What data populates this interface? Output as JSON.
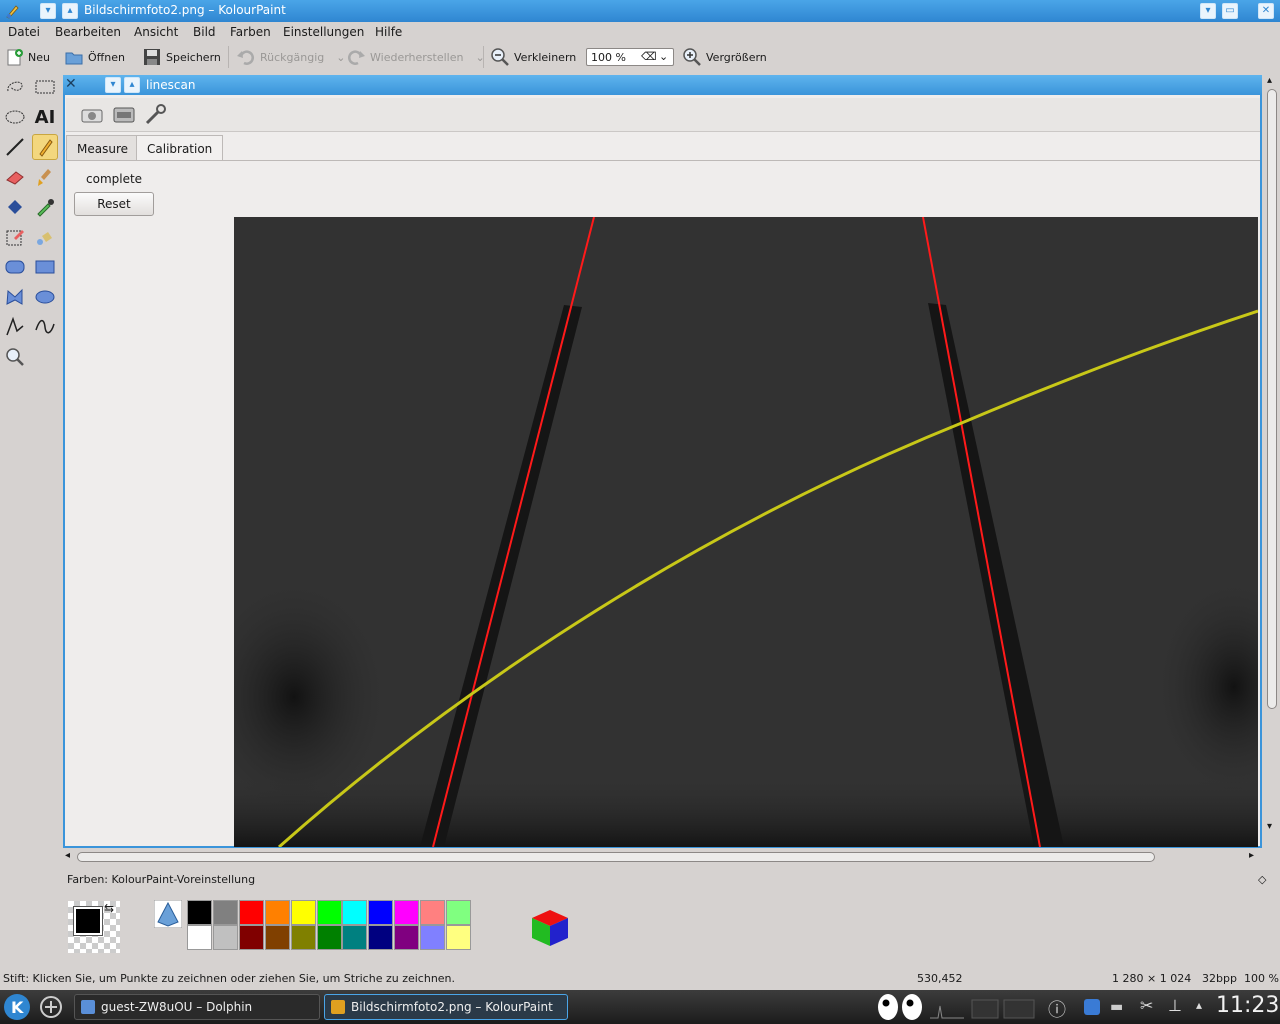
{
  "window": {
    "title": "Bildschirmfoto2.png – KolourPaint"
  },
  "menu": [
    "Datei",
    "Bearbeiten",
    "Ansicht",
    "Bild",
    "Farben",
    "Einstellungen",
    "Hilfe"
  ],
  "toolbar": {
    "new": "Neu",
    "open": "Öffnen",
    "save": "Speichern",
    "undo": "Rückgängig",
    "redo": "Wiederherstellen",
    "zoom_out": "Verkleinern",
    "zoom_value": "100 %",
    "zoom_in": "Vergrößern"
  },
  "plugin": {
    "title": "linescan",
    "tabs": [
      "Measure",
      "Calibration"
    ],
    "active_tab": "Calibration",
    "status": "complete",
    "reset_label": "Reset"
  },
  "colors": {
    "label": "Farben: KolourPaint-Voreinstellung",
    "foreground": "#000000",
    "background": "#ffffff",
    "palette_top": [
      "#000000",
      "#808080",
      "#ff0000",
      "#ff8000",
      "#ffff00",
      "#00ff00",
      "#00ffff",
      "#0000ff",
      "#ff00ff",
      "#ff8080",
      "#80ff80"
    ],
    "palette_bottom": [
      "#ffffff",
      "#c0c0c0",
      "#800000",
      "#804000",
      "#808000",
      "#008000",
      "#008080",
      "#000080",
      "#800080",
      "#8080ff",
      "#ffff80"
    ]
  },
  "status": {
    "hint": "Stift: Klicken Sie, um Punkte zu zeichnen oder ziehen Sie, um Striche zu zeichnen.",
    "coords": "530,452",
    "size": "1 280 × 1 024",
    "depth": "32bpp",
    "zoom": "100 %"
  },
  "taskbar": {
    "task1": "guest-ZW8uOU – Dolphin",
    "task2": "Bildschirmfoto2.png – KolourPaint",
    "clock": "11:23"
  }
}
